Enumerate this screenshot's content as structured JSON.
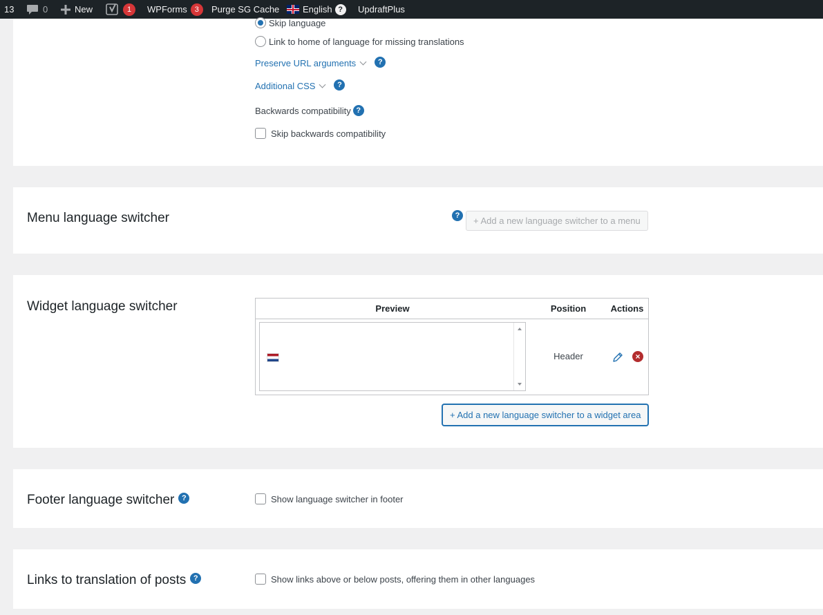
{
  "adminbar": {
    "updates_count": "13",
    "comments_count": "0",
    "new_label": "New",
    "yoast_badge": "1",
    "wpforms_label": "WPForms",
    "wpforms_badge": "3",
    "purge_label": "Purge SG Cache",
    "language_label": "English",
    "language_help": "?",
    "updraft_label": "UpdraftPlus"
  },
  "top_section": {
    "radio_skip_language": "Skip language",
    "radio_link_home": "Link to home of language for missing translations",
    "preserve_url_label": "Preserve URL arguments",
    "additional_css_label": "Additional CSS",
    "backwards_label": "Backwards compatibility",
    "skip_backwards_label": "Skip backwards compatibility",
    "selected_radio": "skip_language"
  },
  "menu_switcher": {
    "title": "Menu language switcher",
    "add_button": "+ Add a new language switcher to a menu"
  },
  "widget_switcher": {
    "title": "Widget language switcher",
    "columns": [
      "Preview",
      "Position",
      "Actions"
    ],
    "rows": [
      {
        "preview_flag": "nl-flag",
        "position": "Header"
      }
    ],
    "add_button": "+ Add a new language switcher to a widget area"
  },
  "footer_switcher": {
    "title": "Footer language switcher",
    "checkbox_label": "Show language switcher in footer"
  },
  "post_links": {
    "title": "Links to translation of posts",
    "checkbox_label": "Show links above or below posts, offering them in other languages"
  },
  "help_glyph": "?",
  "colors": {
    "adminbar_bg": "#1d2327",
    "page_bg": "#f0f0f1",
    "panel_bg": "#ffffff",
    "accent": "#2271b1",
    "badge_red": "#d63638",
    "delete_red": "#b32d2e"
  }
}
